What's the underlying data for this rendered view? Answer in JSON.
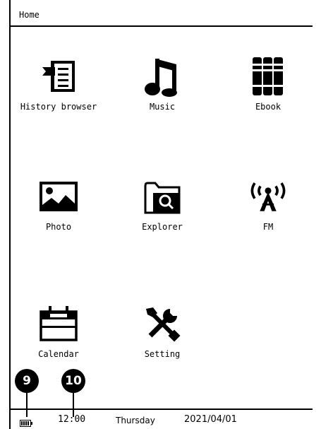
{
  "header": {
    "title": "Home"
  },
  "apps": [
    {
      "label": "History browser",
      "icon": "history-browser-icon"
    },
    {
      "label": "Music",
      "icon": "music-note-icon"
    },
    {
      "label": "Ebook",
      "icon": "books-icon"
    },
    {
      "label": "Photo",
      "icon": "photo-icon"
    },
    {
      "label": "Explorer",
      "icon": "folder-search-icon"
    },
    {
      "label": "FM",
      "icon": "radio-tower-icon"
    },
    {
      "label": "Calendar",
      "icon": "calendar-icon"
    },
    {
      "label": "Setting",
      "icon": "tools-icon"
    }
  ],
  "status": {
    "battery_icon": "battery-icon",
    "time": "12:00",
    "day": "Thursday",
    "date": "2021/04/01"
  },
  "callouts": {
    "battery": "9",
    "time": "10"
  }
}
